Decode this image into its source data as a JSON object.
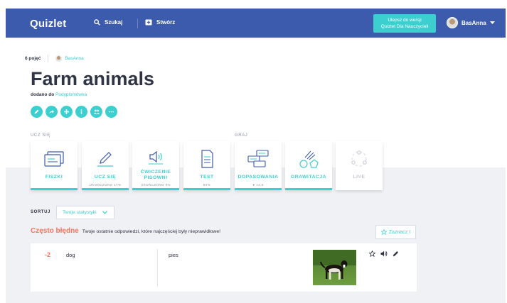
{
  "topbar": {
    "logo": "Quizlet",
    "search_label": "Szukaj",
    "create_label": "Stwórz",
    "upgrade_line1": "Ulepsz do wersji",
    "upgrade_line2": "Quizlet Dla Nauczycieli",
    "username": "BasAnna"
  },
  "set": {
    "term_count": "6 pojęć",
    "author": "BasAnna",
    "title": "Farm animals",
    "added_prefix": "dodano do",
    "added_folder": "Podyplomówka"
  },
  "sections": {
    "study": "UCZ SIĘ",
    "play": "GRAJ"
  },
  "modes": [
    {
      "label": "FISZKI",
      "sub": ""
    },
    {
      "label": "UCZ SIĘ",
      "sub": "UKOŃCZONO 17%"
    },
    {
      "label": "ĆWICZENIE PISOWNI",
      "sub": "UKOŃCZONO 0%"
    },
    {
      "label": "TEST",
      "sub": "50%"
    },
    {
      "label": "DOPASOWANIA",
      "sub": "● 14.5"
    },
    {
      "label": "GRAWITACJA",
      "sub": ""
    },
    {
      "label": "LIVE",
      "sub": ""
    }
  ],
  "sort": {
    "label": "SORTUJ",
    "selected": "Twoje statystyki"
  },
  "often_wrong": {
    "title": "Często błędne",
    "description": "Twoje ostatnie odpowiedzi, które najczęściej były nieprawidłowe!",
    "mark_button": "Zaznacz I"
  },
  "term_row": {
    "score": "-2",
    "term": "dog",
    "definition": "pies"
  },
  "colors": {
    "brand": "#3d5bad",
    "accent": "#3ccfcf",
    "error": "#ff725b"
  }
}
